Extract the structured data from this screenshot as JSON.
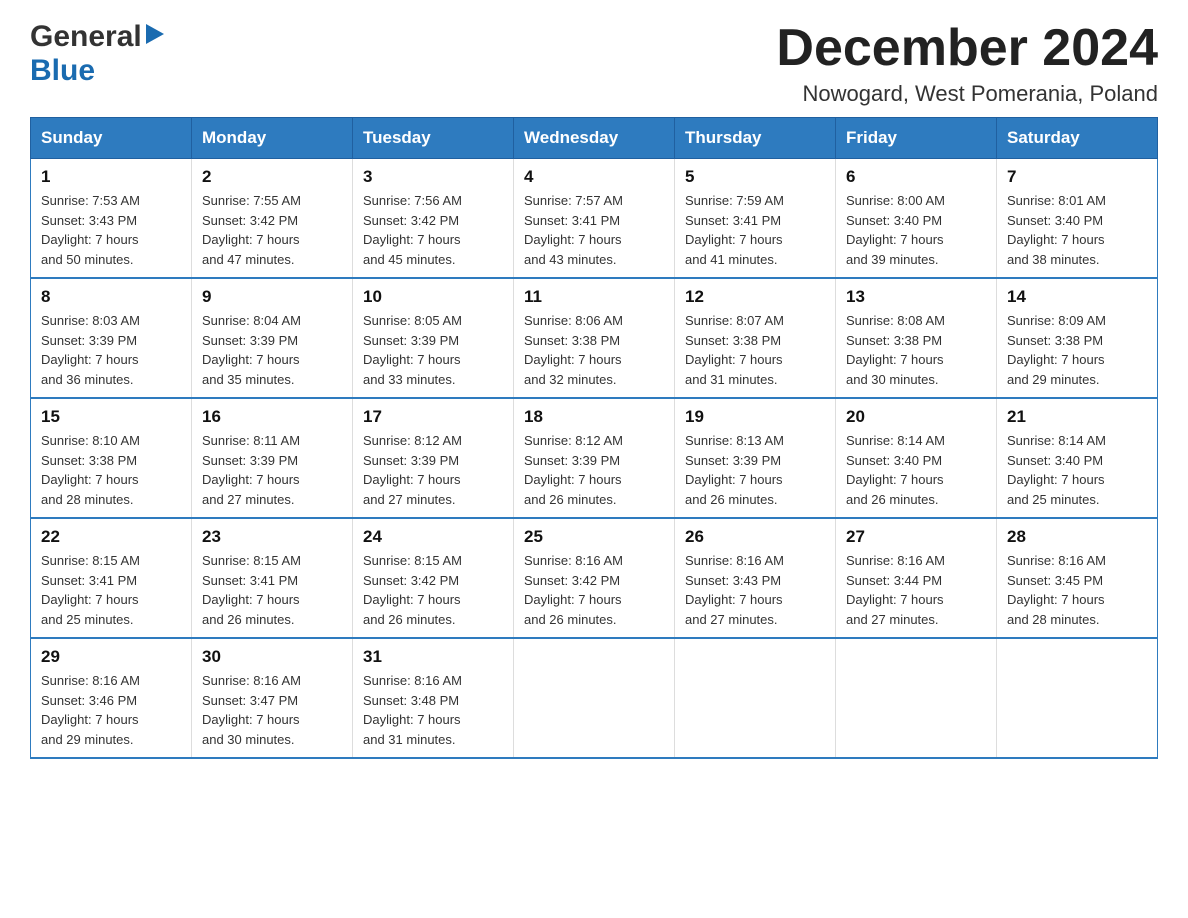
{
  "logo": {
    "general": "General",
    "blue": "Blue",
    "arrow": "▶"
  },
  "title": {
    "month": "December 2024",
    "location": "Nowogard, West Pomerania, Poland"
  },
  "weekdays": [
    "Sunday",
    "Monday",
    "Tuesday",
    "Wednesday",
    "Thursday",
    "Friday",
    "Saturday"
  ],
  "weeks": [
    [
      {
        "day": "1",
        "sunrise": "7:53 AM",
        "sunset": "3:43 PM",
        "daylight": "7 hours and 50 minutes."
      },
      {
        "day": "2",
        "sunrise": "7:55 AM",
        "sunset": "3:42 PM",
        "daylight": "7 hours and 47 minutes."
      },
      {
        "day": "3",
        "sunrise": "7:56 AM",
        "sunset": "3:42 PM",
        "daylight": "7 hours and 45 minutes."
      },
      {
        "day": "4",
        "sunrise": "7:57 AM",
        "sunset": "3:41 PM",
        "daylight": "7 hours and 43 minutes."
      },
      {
        "day": "5",
        "sunrise": "7:59 AM",
        "sunset": "3:41 PM",
        "daylight": "7 hours and 41 minutes."
      },
      {
        "day": "6",
        "sunrise": "8:00 AM",
        "sunset": "3:40 PM",
        "daylight": "7 hours and 39 minutes."
      },
      {
        "day": "7",
        "sunrise": "8:01 AM",
        "sunset": "3:40 PM",
        "daylight": "7 hours and 38 minutes."
      }
    ],
    [
      {
        "day": "8",
        "sunrise": "8:03 AM",
        "sunset": "3:39 PM",
        "daylight": "7 hours and 36 minutes."
      },
      {
        "day": "9",
        "sunrise": "8:04 AM",
        "sunset": "3:39 PM",
        "daylight": "7 hours and 35 minutes."
      },
      {
        "day": "10",
        "sunrise": "8:05 AM",
        "sunset": "3:39 PM",
        "daylight": "7 hours and 33 minutes."
      },
      {
        "day": "11",
        "sunrise": "8:06 AM",
        "sunset": "3:38 PM",
        "daylight": "7 hours and 32 minutes."
      },
      {
        "day": "12",
        "sunrise": "8:07 AM",
        "sunset": "3:38 PM",
        "daylight": "7 hours and 31 minutes."
      },
      {
        "day": "13",
        "sunrise": "8:08 AM",
        "sunset": "3:38 PM",
        "daylight": "7 hours and 30 minutes."
      },
      {
        "day": "14",
        "sunrise": "8:09 AM",
        "sunset": "3:38 PM",
        "daylight": "7 hours and 29 minutes."
      }
    ],
    [
      {
        "day": "15",
        "sunrise": "8:10 AM",
        "sunset": "3:38 PM",
        "daylight": "7 hours and 28 minutes."
      },
      {
        "day": "16",
        "sunrise": "8:11 AM",
        "sunset": "3:39 PM",
        "daylight": "7 hours and 27 minutes."
      },
      {
        "day": "17",
        "sunrise": "8:12 AM",
        "sunset": "3:39 PM",
        "daylight": "7 hours and 27 minutes."
      },
      {
        "day": "18",
        "sunrise": "8:12 AM",
        "sunset": "3:39 PM",
        "daylight": "7 hours and 26 minutes."
      },
      {
        "day": "19",
        "sunrise": "8:13 AM",
        "sunset": "3:39 PM",
        "daylight": "7 hours and 26 minutes."
      },
      {
        "day": "20",
        "sunrise": "8:14 AM",
        "sunset": "3:40 PM",
        "daylight": "7 hours and 26 minutes."
      },
      {
        "day": "21",
        "sunrise": "8:14 AM",
        "sunset": "3:40 PM",
        "daylight": "7 hours and 25 minutes."
      }
    ],
    [
      {
        "day": "22",
        "sunrise": "8:15 AM",
        "sunset": "3:41 PM",
        "daylight": "7 hours and 25 minutes."
      },
      {
        "day": "23",
        "sunrise": "8:15 AM",
        "sunset": "3:41 PM",
        "daylight": "7 hours and 26 minutes."
      },
      {
        "day": "24",
        "sunrise": "8:15 AM",
        "sunset": "3:42 PM",
        "daylight": "7 hours and 26 minutes."
      },
      {
        "day": "25",
        "sunrise": "8:16 AM",
        "sunset": "3:42 PM",
        "daylight": "7 hours and 26 minutes."
      },
      {
        "day": "26",
        "sunrise": "8:16 AM",
        "sunset": "3:43 PM",
        "daylight": "7 hours and 27 minutes."
      },
      {
        "day": "27",
        "sunrise": "8:16 AM",
        "sunset": "3:44 PM",
        "daylight": "7 hours and 27 minutes."
      },
      {
        "day": "28",
        "sunrise": "8:16 AM",
        "sunset": "3:45 PM",
        "daylight": "7 hours and 28 minutes."
      }
    ],
    [
      {
        "day": "29",
        "sunrise": "8:16 AM",
        "sunset": "3:46 PM",
        "daylight": "7 hours and 29 minutes."
      },
      {
        "day": "30",
        "sunrise": "8:16 AM",
        "sunset": "3:47 PM",
        "daylight": "7 hours and 30 minutes."
      },
      {
        "day": "31",
        "sunrise": "8:16 AM",
        "sunset": "3:48 PM",
        "daylight": "7 hours and 31 minutes."
      },
      null,
      null,
      null,
      null
    ]
  ],
  "labels": {
    "sunrise": "Sunrise:",
    "sunset": "Sunset:",
    "daylight": "Daylight:"
  }
}
